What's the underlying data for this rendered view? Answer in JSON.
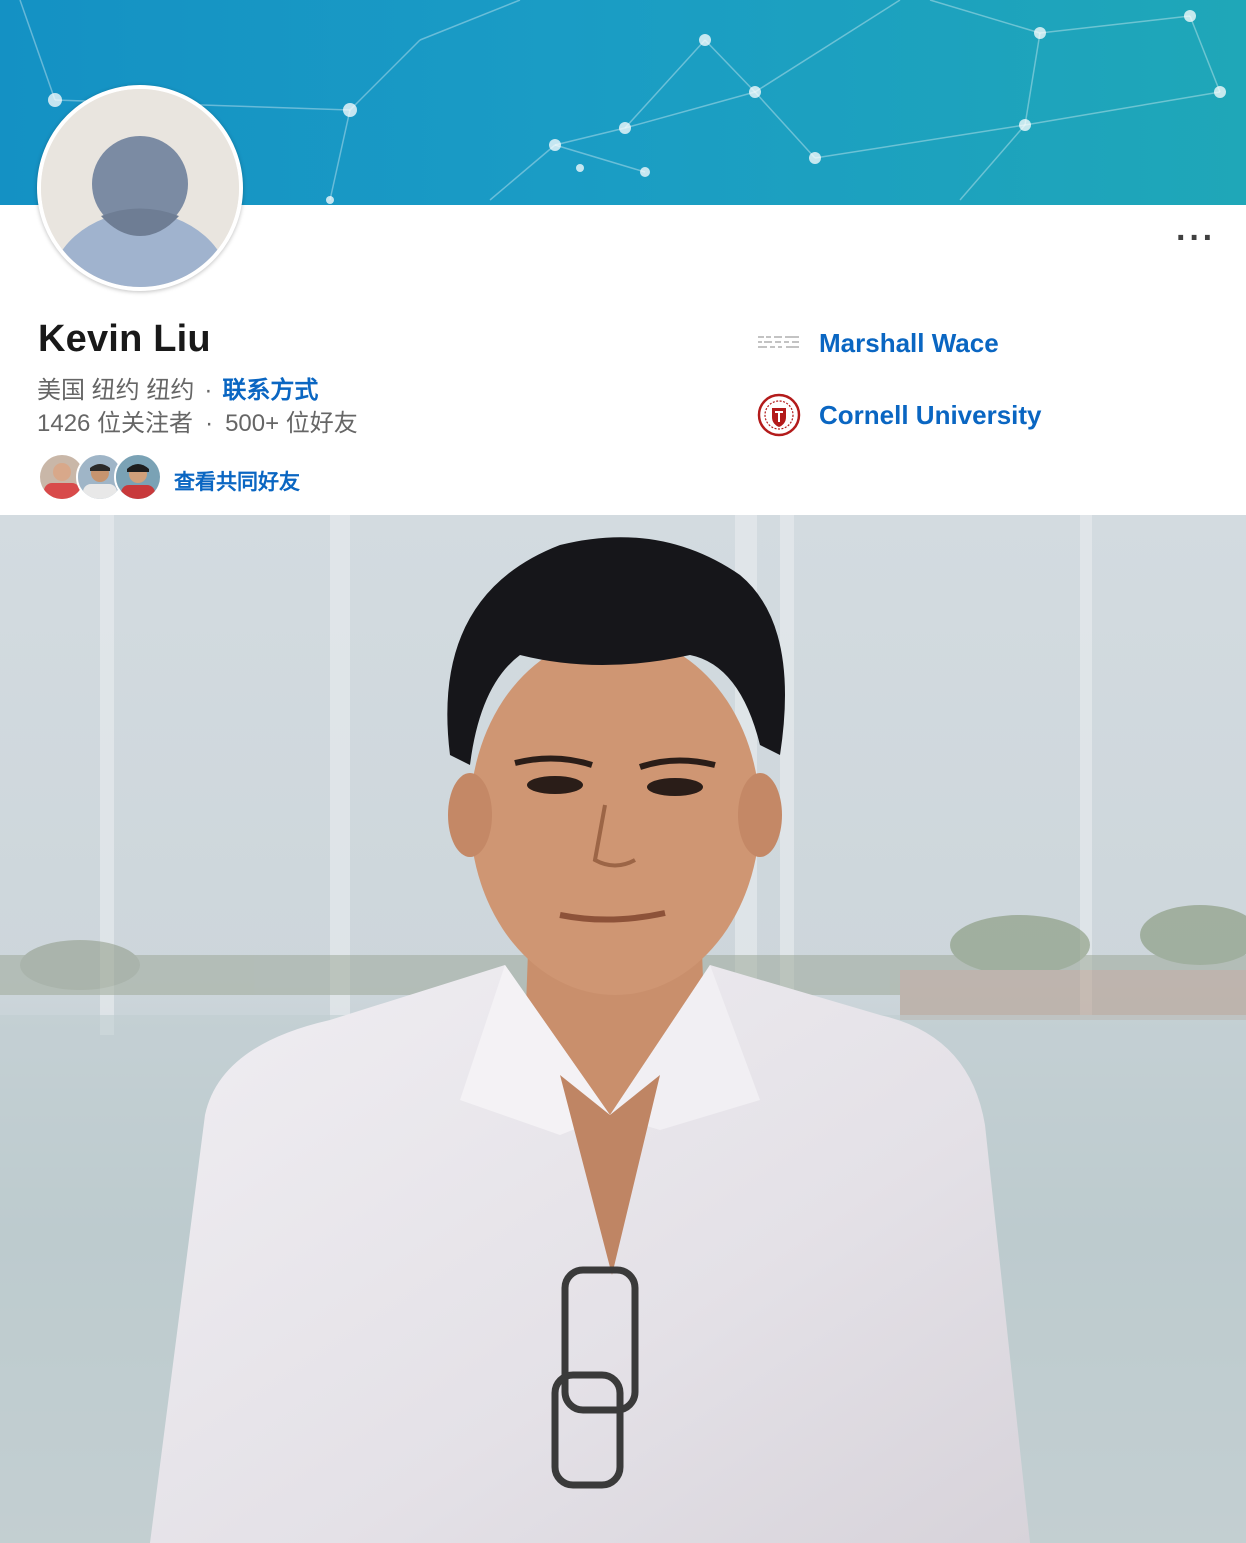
{
  "profile": {
    "name": "Kevin Liu",
    "location": "美国 纽约 纽约",
    "location_separator": "·",
    "contact_link": "联系方式",
    "followers": "1426 位关注者",
    "stats_separator": "·",
    "connections": "500+ 位好友",
    "mutual_link": "查看共同好友",
    "more_label": "···"
  },
  "organizations": [
    {
      "label": "Marshall Wace",
      "icon": "company-logo-icon"
    },
    {
      "label": "Cornell University",
      "icon": "cornell-seal-icon"
    }
  ],
  "colors": {
    "banner": "#1a9cc5",
    "link": "#0a66c2",
    "name": "#191919",
    "secondary_text": "#666666"
  }
}
